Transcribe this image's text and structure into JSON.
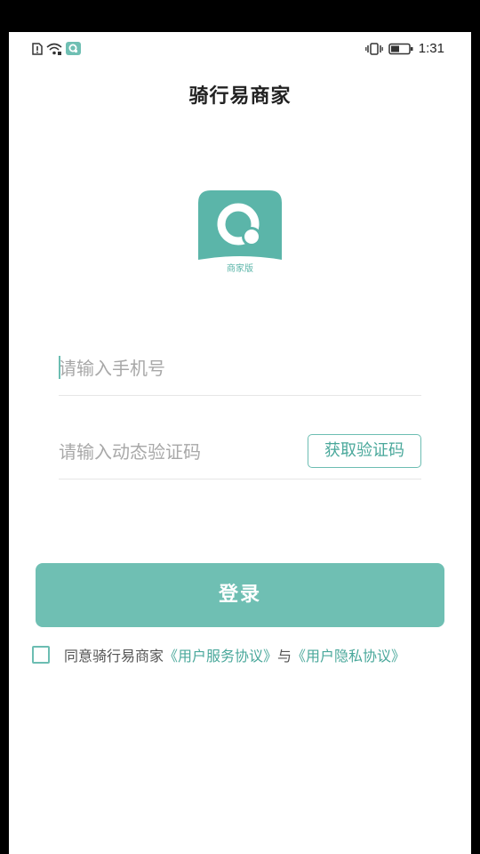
{
  "status_bar": {
    "time": "1:31",
    "left_icons": [
      "sim-alert-icon",
      "wifi-icon",
      "app-notification-icon"
    ],
    "right_icons": [
      "vibrate-icon",
      "battery-icon"
    ]
  },
  "app": {
    "title": "骑行易商家",
    "logo_caption": "商家版",
    "brand_color": "#6fbfb3"
  },
  "form": {
    "phone_placeholder": "请输入手机号",
    "code_placeholder": "请输入动态验证码",
    "get_code_label": "获取验证码",
    "login_label": "登录"
  },
  "agreement": {
    "prefix": "同意骑行易商家",
    "service_link": "《用户服务协议》",
    "joiner": "与",
    "privacy_link": "《用户隐私协议》",
    "checked": false
  }
}
